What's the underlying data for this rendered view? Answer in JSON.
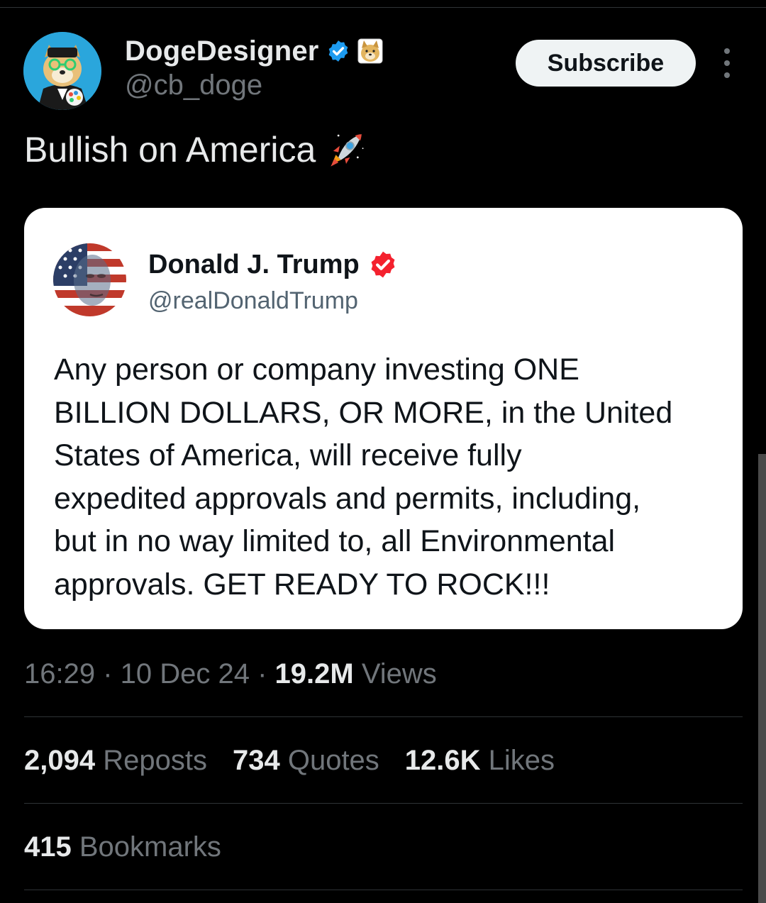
{
  "author": {
    "name": "DogeDesigner",
    "handle": "@cb_doge",
    "verified_color": "#1d9bf0"
  },
  "header": {
    "subscribe_label": "Subscribe"
  },
  "tweet": {
    "text": "Bullish on America",
    "emoji": "rocket-icon"
  },
  "quoted_tweet": {
    "name": "Donald J. Trump",
    "handle": "@realDonaldTrump",
    "verified_color": "#f4212e",
    "lines": [
      "Any person or company investing ONE",
      "BILLION DOLLARS, OR MORE, in the United",
      "States of America, will receive fully",
      "expedited approvals and permits, including,",
      "but in no way limited to, all Environmental",
      "approvals. GET READY TO ROCK!!!"
    ]
  },
  "meta": {
    "time": "16:29",
    "sep": " · ",
    "date": "10 Dec 24",
    "views_count": "19.2M",
    "views_label": " Views"
  },
  "stats": {
    "reposts_count": "2,094",
    "reposts_label": " Reposts",
    "quotes_count": "734",
    "quotes_label": " Quotes",
    "likes_count": "12.6K",
    "likes_label": " Likes",
    "bookmarks_count": "415",
    "bookmarks_label": " Bookmarks"
  }
}
